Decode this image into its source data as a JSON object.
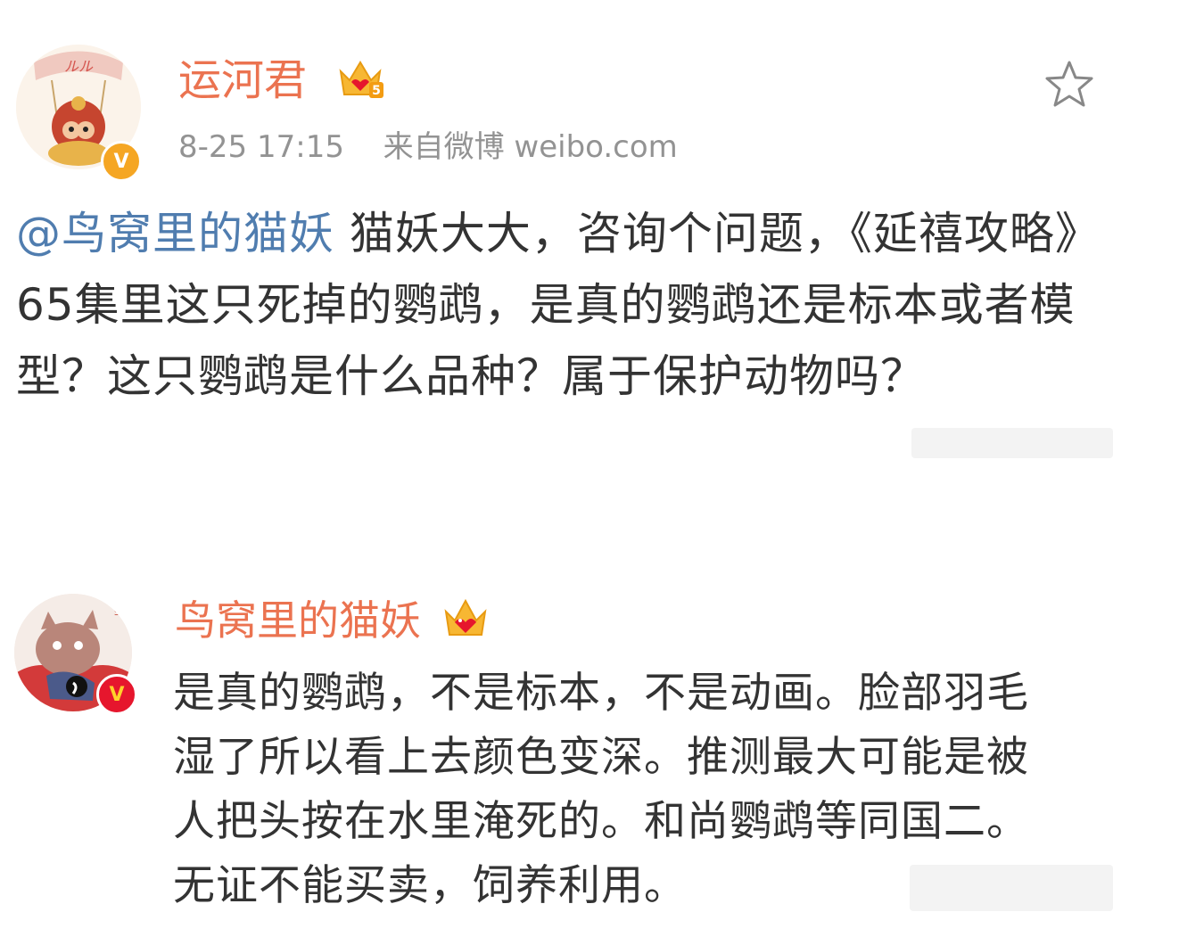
{
  "post": {
    "username": "运河君",
    "crown_level": "5",
    "date": "8-25 17:15",
    "source": "来自微博 weibo.com",
    "mention": "@鸟窝里的猫妖",
    "text": " 猫妖大大，咨询个问题，《延禧攻略》65集里这只死掉的鹦鹉，是真的鹦鹉还是标本或者模型？这只鹦鹉是什么品种？属于保护动物吗？"
  },
  "reply": {
    "username": "鸟窝里的猫妖",
    "text": "是真的鹦鹉，不是标本，不是动画。脸部羽毛湿了所以看上去颜色变深。推测最大可能是被人把头按在水里淹死的。和尚鹦鹉等同国二。无证不能买卖，饲养利用。"
  },
  "colors": {
    "username": "#eb7350",
    "mention": "#507daf",
    "meta": "#939393",
    "verified_gold": "#f5a623",
    "verified_red": "#e6162d"
  },
  "icons": {
    "favorite": "star-outline-icon",
    "crown": "crown-icon",
    "verified": "verified-v-icon"
  }
}
